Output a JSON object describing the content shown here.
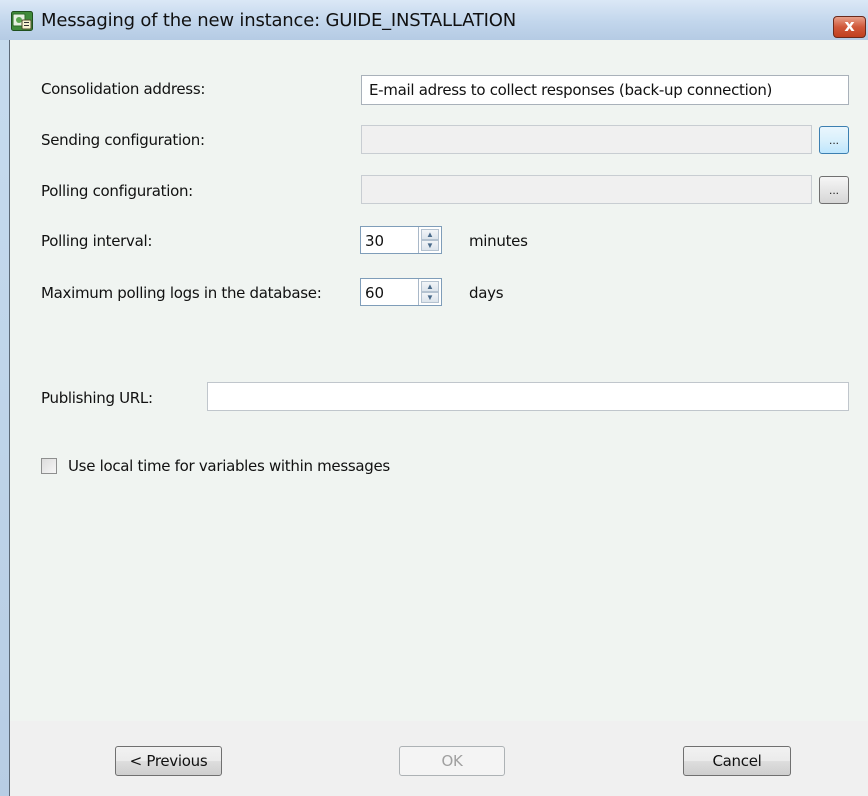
{
  "window": {
    "title": "Messaging of the new instance: GUIDE_INSTALLATION",
    "close_label": "x"
  },
  "form": {
    "consolidation_label": "Consolidation address:",
    "consolidation_value": "E-mail adress to collect responses (back-up connection)",
    "sending_label": "Sending configuration:",
    "sending_value": "",
    "sending_browse": "...",
    "polling_config_label": "Polling configuration:",
    "polling_config_value": "",
    "polling_browse": "...",
    "polling_interval_label": "Polling interval:",
    "polling_interval_value": "30",
    "polling_interval_unit": "minutes",
    "max_logs_label": "Maximum polling logs in the database:",
    "max_logs_value": "60",
    "max_logs_unit": "days",
    "publishing_label": "Publishing URL:",
    "publishing_value": "",
    "local_time_label": "Use local time for variables within messages",
    "local_time_checked": false
  },
  "buttons": {
    "previous": "< Previous",
    "ok": "OK",
    "cancel": "Cancel"
  },
  "colors": {
    "titlebar": "#c2d6ec",
    "client_bg": "#f0f4f1",
    "close_red": "#c1401f"
  }
}
